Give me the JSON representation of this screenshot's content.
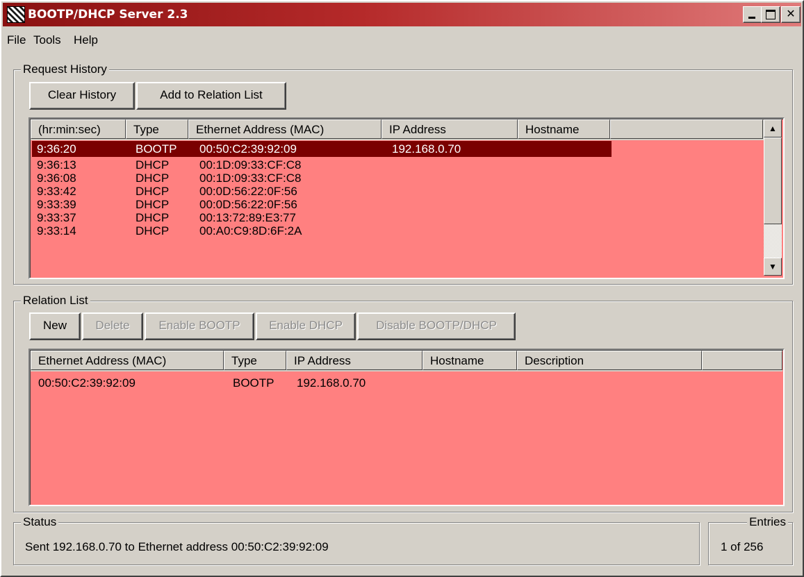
{
  "window": {
    "title": "BOOTP/DHCP Server 2.3"
  },
  "menu": [
    "File",
    "Tools",
    "Help"
  ],
  "request_history": {
    "group_label": "Request History",
    "buttons": {
      "clear": "Clear History",
      "add": "Add to Relation List"
    },
    "columns": [
      "(hr:min:sec)",
      "Type",
      "Ethernet Address (MAC)",
      "IP Address",
      "Hostname"
    ],
    "rows": [
      {
        "time": "9:36:20",
        "type": "BOOTP",
        "mac": "00:50:C2:39:92:09",
        "ip": "192.168.0.70",
        "hostname": "",
        "selected": true
      },
      {
        "time": "9:36:13",
        "type": "DHCP",
        "mac": "00:1D:09:33:CF:C8",
        "ip": "",
        "hostname": ""
      },
      {
        "time": "9:36:08",
        "type": "DHCP",
        "mac": "00:1D:09:33:CF:C8",
        "ip": "",
        "hostname": ""
      },
      {
        "time": "9:33:42",
        "type": "DHCP",
        "mac": "00:0D:56:22:0F:56",
        "ip": "",
        "hostname": ""
      },
      {
        "time": "9:33:39",
        "type": "DHCP",
        "mac": "00:0D:56:22:0F:56",
        "ip": "",
        "hostname": ""
      },
      {
        "time": "9:33:37",
        "type": "DHCP",
        "mac": "00:13:72:89:E3:77",
        "ip": "",
        "hostname": ""
      },
      {
        "time": "9:33:14",
        "type": "DHCP",
        "mac": "00:A0:C9:8D:6F:2A",
        "ip": "",
        "hostname": ""
      }
    ]
  },
  "relation_list": {
    "group_label": "Relation List",
    "buttons": {
      "new": "New",
      "delete": "Delete",
      "enable_bootp": "Enable BOOTP",
      "enable_dhcp": "Enable DHCP",
      "disable": "Disable BOOTP/DHCP"
    },
    "columns": [
      "Ethernet Address (MAC)",
      "Type",
      "IP Address",
      "Hostname",
      "Description"
    ],
    "rows": [
      {
        "mac": "00:50:C2:39:92:09",
        "type": "BOOTP",
        "ip": "192.168.0.70",
        "hostname": "",
        "description": ""
      }
    ]
  },
  "status": {
    "label": "Status",
    "text": "Sent 192.168.0.70 to Ethernet address 00:50:C2:39:92:09"
  },
  "entries": {
    "label": "Entries",
    "text": "1 of 256"
  },
  "colors": {
    "list_bg": "#ff8080",
    "selection": "#7a0000",
    "title_start": "#8a1111",
    "title_end": "#e07a7a",
    "face": "#d4d0c8"
  }
}
